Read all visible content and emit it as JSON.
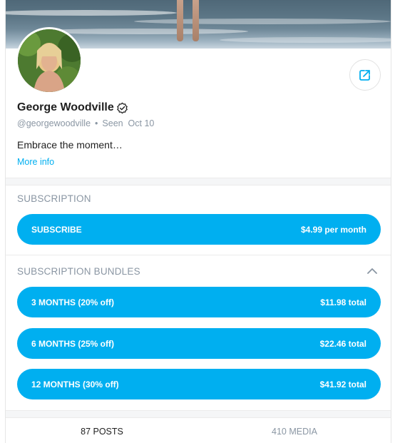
{
  "profile": {
    "name": "George Woodville",
    "handle": "@georgewoodville",
    "separator": "•",
    "seen": "Seen  Oct 10",
    "bio": "Embrace the moment…",
    "more_info": "More info"
  },
  "subscription": {
    "title": "SUBSCRIPTION",
    "button_label": "SUBSCRIBE",
    "button_price": "$4.99 per month"
  },
  "bundles": {
    "title": "SUBSCRIPTION BUNDLES",
    "items": [
      {
        "label": "3 MONTHS (20% off)",
        "price": "$11.98 total"
      },
      {
        "label": "6 MONTHS (25% off)",
        "price": "$22.46 total"
      },
      {
        "label": "12 MONTHS (30% off)",
        "price": "$41.92 total"
      }
    ]
  },
  "tabs": [
    {
      "label": "87 POSTS"
    },
    {
      "label": "410 MEDIA"
    }
  ],
  "colors": {
    "accent": "#00aff0",
    "muted_text": "#8a96a3"
  },
  "icons": {
    "verified": "verified-badge-icon",
    "share": "share-icon",
    "collapse": "chevron-up-icon"
  }
}
